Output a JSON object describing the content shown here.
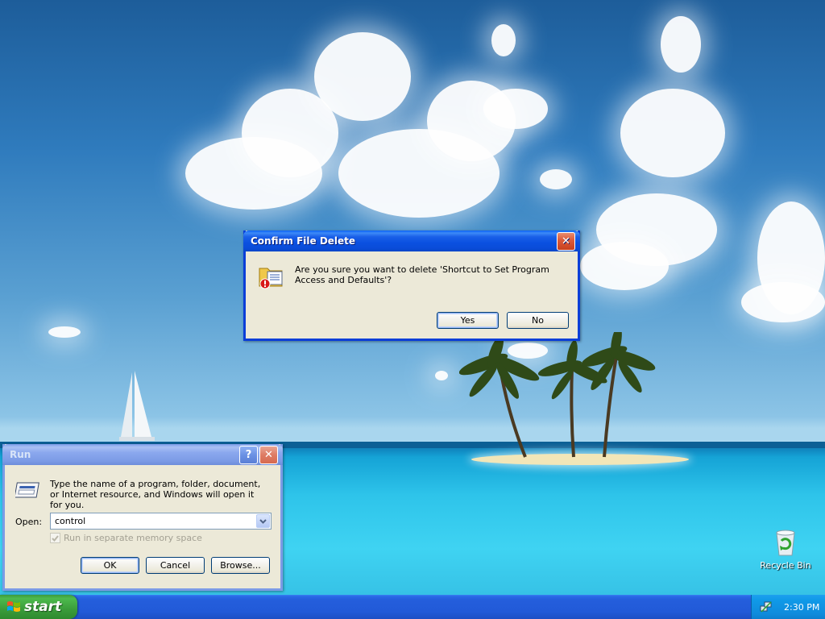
{
  "confirm_dialog": {
    "title": "Confirm File Delete",
    "message": "Are you sure you want to delete 'Shortcut to Set Program Access and Defaults'?",
    "yes_label": "Yes",
    "no_label": "No",
    "close_glyph": "✕"
  },
  "run_dialog": {
    "title": "Run",
    "help_glyph": "?",
    "close_glyph": "✕",
    "description": "Type the name of a program, folder, document, or Internet resource, and Windows will open it for you.",
    "open_label": "Open:",
    "open_value": "control",
    "checkbox_label": "Run in separate memory space",
    "checkbox_checked": true,
    "checkbox_enabled": false,
    "ok_label": "OK",
    "cancel_label": "Cancel",
    "browse_label": "Browse..."
  },
  "desktop": {
    "icons": [
      {
        "label": "Recycle Bin",
        "icon": "recycle-bin-icon"
      }
    ]
  },
  "taskbar": {
    "start_label": "start",
    "clock": "2:30 PM",
    "tray_icons": [
      "network-icon"
    ]
  },
  "colors": {
    "title_active": "#0a50e0",
    "title_inactive": "#7c9be6",
    "dialog_face": "#ece9d8",
    "taskbar": "#245edc",
    "start_green": "#3a9c3a"
  }
}
